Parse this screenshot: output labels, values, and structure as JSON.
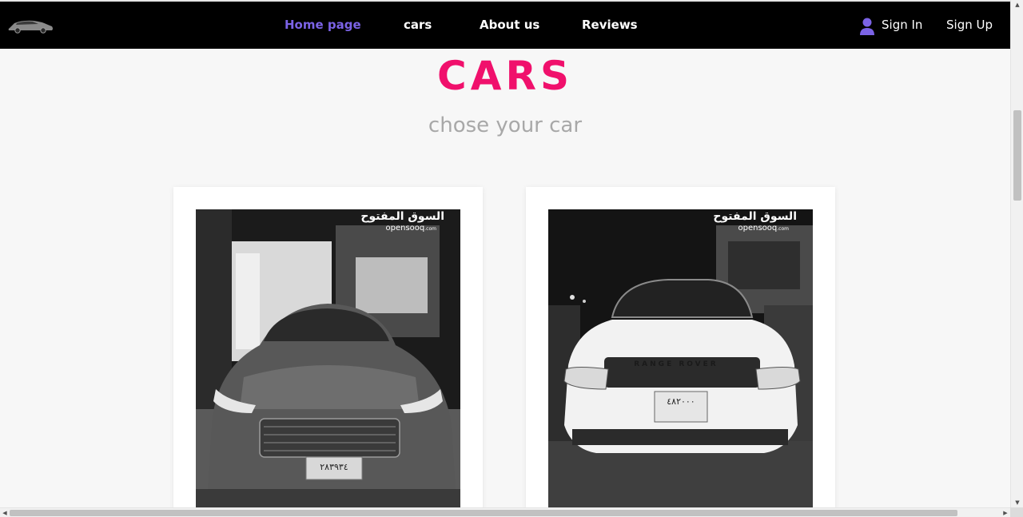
{
  "nav": {
    "logo_icon": "car-logo-icon",
    "links": [
      {
        "label": "Home page",
        "active": true
      },
      {
        "label": "cars",
        "active": false
      },
      {
        "label": "About us",
        "active": false
      },
      {
        "label": "Reviews",
        "active": false
      }
    ],
    "sign_in": "Sign In",
    "sign_up": "Sign Up",
    "user_icon": "user-icon"
  },
  "hero": {
    "title": "CARS",
    "subtitle": "chose your car"
  },
  "cards": [
    {
      "watermark_ar": "السوق المفتوح",
      "watermark_en": "opensooq",
      "watermark_com": ".com",
      "plate": "٢٨٣٩٣٤"
    },
    {
      "watermark_ar": "السوق المفتوح",
      "watermark_en": "opensooq",
      "watermark_com": ".com",
      "plate": "٤٨٢٠٠٠",
      "badge": "RANGE ROVER"
    }
  ],
  "colors": {
    "navbar_bg": "#000000",
    "active_link": "#7b63e6",
    "title_accent": "#f0106c",
    "subtitle": "#a8a8a8",
    "page_bg": "#f7f7f7"
  }
}
